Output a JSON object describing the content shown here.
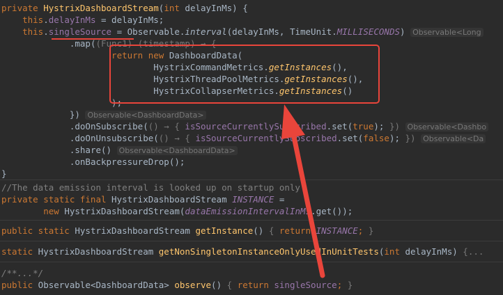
{
  "code": {
    "l1": {
      "kw": "private",
      "name": "HystrixDashboardStream",
      "p1": "(",
      "kw2": "int",
      "p2": " delayInMs) {"
    },
    "l2": {
      "kw": "this",
      "dot": ".",
      "fld": "delayInMs",
      "rest": " = delayInMs;"
    },
    "l3": {
      "kw": "this",
      "dot": ".",
      "fld": "singleSource",
      "a": " = Observable.",
      "m": "interval",
      "b": "(delayInMs, TimeUnit.",
      "c": "MILLISECONDS",
      "d": ")",
      "hint": "Observable<Long"
    },
    "l4": {
      "a": ".map(",
      "fold": "(Func1) (timestamp) → {"
    },
    "l5": {
      "kw1": "return",
      "kw2": " new",
      "rest": " DashboardData("
    },
    "l6": {
      "a": "HystrixCommandMetrics.",
      "m": "getInstances",
      "b": "(),"
    },
    "l7": {
      "a": "HystrixThreadPoolMetrics.",
      "m": "getInstances",
      "b": "(),"
    },
    "l8": {
      "a": "HystrixCollapserMetrics.",
      "m": "getInstances",
      "b": "()"
    },
    "l9": {
      "a": ");"
    },
    "l10": {
      "a": "})",
      "hint": "Observable<DashboardData>"
    },
    "l11": {
      "a": ".doOnSubscribe(",
      "fold": "() → {",
      "f": " isSourceCurrentlySubscribed",
      "b": ".set(",
      "kw": "true",
      "c": ");",
      "fold2": " })",
      "hint": "Observable<Dashbo"
    },
    "l12": {
      "a": ".doOnUnsubscribe(",
      "fold": "() → {",
      "f": " isSourceCurrentlySubscribed",
      "b": ".set(",
      "kw": "false",
      "c": ");",
      "fold2": " })",
      "hint": "Observable<Da"
    },
    "l13": {
      "a": ".share()",
      "hint": "Observable<DashboardData>"
    },
    "l14": {
      "a": ".onBackpressureDrop();"
    },
    "l15": {
      "a": "}"
    },
    "l16": {
      "cmt": "//The data emission interval is looked up on startup only"
    },
    "l17": {
      "kw": "private static final",
      "a": " HystrixDashboardStream ",
      "f": "INSTANCE",
      "b": " ="
    },
    "l18": {
      "kw": "new",
      "a": " HystrixDashboardStream(",
      "f": "dataEmissionIntervalInMs",
      "b": ".get());"
    },
    "l19": {
      "kw": "public static",
      "a": " HystrixDashboardStream ",
      "fn": "getInstance",
      "b": "()",
      "fold": " { ",
      "kw2": "return",
      "f": " INSTANCE",
      "c": ";",
      "fold2": " }"
    },
    "l20": {
      "kw": "static",
      "a": " HystrixDashboardStream ",
      "fn": "getNonSingletonInstanceOnlyUsedInUnitTests",
      "b": "(",
      "kw2": "int",
      "c": " delayInMs)",
      "fold": " {..."
    },
    "l21": {
      "cmt": "/**...*/"
    },
    "l22": {
      "kw": "public",
      "a": " Observable<DashboardData> ",
      "fn": "observe",
      "b": "()",
      "fold": " { ",
      "kw2": "return",
      "f": " singleSource",
      "c": ";",
      "fold2": " }"
    }
  },
  "annotation": {
    "color": "#e9453b"
  }
}
